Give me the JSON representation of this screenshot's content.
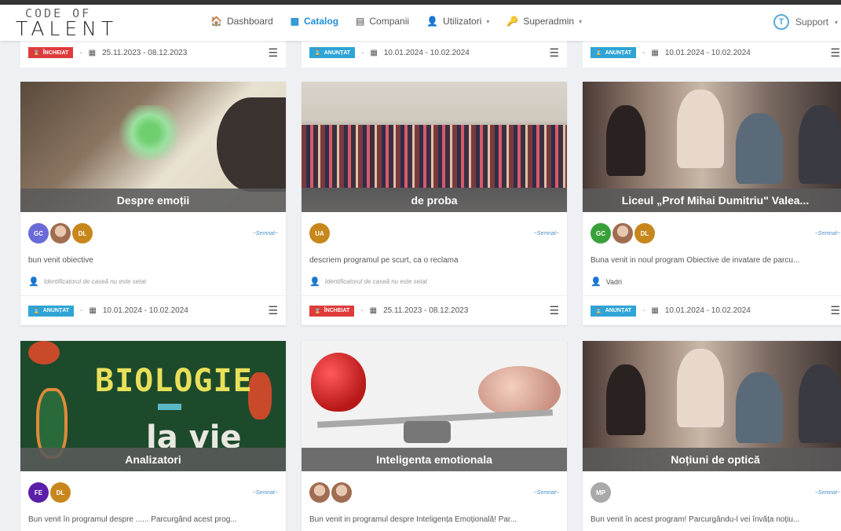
{
  "logo": {
    "line1": "CODE OF",
    "line2": "TALENT"
  },
  "nav": [
    {
      "label": "Dashboard",
      "icon": "🏠",
      "caret": "",
      "active": false
    },
    {
      "label": "Catalog",
      "icon": "▦",
      "caret": "",
      "active": true
    },
    {
      "label": "Companii",
      "icon": "▤",
      "caret": "",
      "active": false
    },
    {
      "label": "Utilizatori",
      "icon": "👤",
      "caret": "▾",
      "active": false
    },
    {
      "label": "Superadmin",
      "icon": "🔑",
      "caret": "▾",
      "active": false
    }
  ],
  "support": {
    "label": "Support",
    "badge": "T",
    "caret": "▾"
  },
  "top_strips": [
    {
      "status": "ÎNCHEIAT",
      "status_color": "red",
      "dates": "25.11.2023 - 08.12.2023"
    },
    {
      "status": "ANUNȚAT",
      "status_color": "blue",
      "dates": "10.01.2024 - 10.02.2024"
    },
    {
      "status": "ANUNȚAT",
      "status_color": "blue",
      "dates": "10.01.2024 - 10.02.2024"
    }
  ],
  "cards": [
    {
      "title": "Despre emoții",
      "avatars": [
        {
          "initials": "GC",
          "color": "#6a6ad8",
          "photo": false
        },
        {
          "initials": "",
          "color": "",
          "photo": true
        },
        {
          "initials": "DL",
          "color": "#c8871c",
          "photo": false
        }
      ],
      "signature": "~Semnat~",
      "description": "bun venit obiective",
      "responsible": "Identificatorul de caseă nu este setat",
      "responsible_named": false,
      "status": "ANUNȚAT",
      "status_color": "blue",
      "dates": "10.01.2024 - 10.02.2024"
    },
    {
      "title": "de proba",
      "avatars": [
        {
          "initials": "UA",
          "color": "#c8871c",
          "photo": false
        }
      ],
      "signature": "~Semnat~",
      "description": "descriem programul pe scurt, ca o reclama",
      "responsible": "Identificatorul de caseă nu este setat",
      "responsible_named": false,
      "status": "ÎNCHEIAT",
      "status_color": "red",
      "dates": "25.11.2023 - 08.12.2023"
    },
    {
      "title": "Liceul „Prof Mihai Dumitriu\" Valea...",
      "avatars": [
        {
          "initials": "GC",
          "color": "#3aa13a",
          "photo": false
        },
        {
          "initials": "",
          "color": "",
          "photo": true
        },
        {
          "initials": "DL",
          "color": "#c8871c",
          "photo": false
        }
      ],
      "signature": "~Semnat~",
      "description": "Buna venit in noul program Obiective de invatare de parcu...",
      "responsible": "Vadri",
      "responsible_named": true,
      "status": "ANUNȚAT",
      "status_color": "blue",
      "dates": "10.01.2024 - 10.02.2024"
    },
    {
      "title": "Analizatori",
      "image_text_1": "BIOLOGIE",
      "image_text_2": "la vie",
      "avatars": [
        {
          "initials": "FE",
          "color": "#5a1fa8",
          "photo": false
        },
        {
          "initials": "DL",
          "color": "#c8871c",
          "photo": false
        }
      ],
      "signature": "~Semnat~",
      "description": "Bun venit în programul despre ...... Parcurgând acest prog..."
    },
    {
      "title": "Inteligenta emotionala",
      "avatars": [
        {
          "initials": "",
          "color": "",
          "photo": true
        },
        {
          "initials": "",
          "color": "",
          "photo": true
        }
      ],
      "signature": "~Semnat~",
      "description": "Bun venit in programul despre Inteligența Emoțională! Par..."
    },
    {
      "title": "Noțiuni de optică",
      "avatars": [
        {
          "initials": "MP",
          "color": "#a9a9a9",
          "photo": false
        }
      ],
      "signature": "~Semnat~",
      "description": "Bun venit în acest program! Parcurgându-l vei învăța noțiu..."
    }
  ]
}
